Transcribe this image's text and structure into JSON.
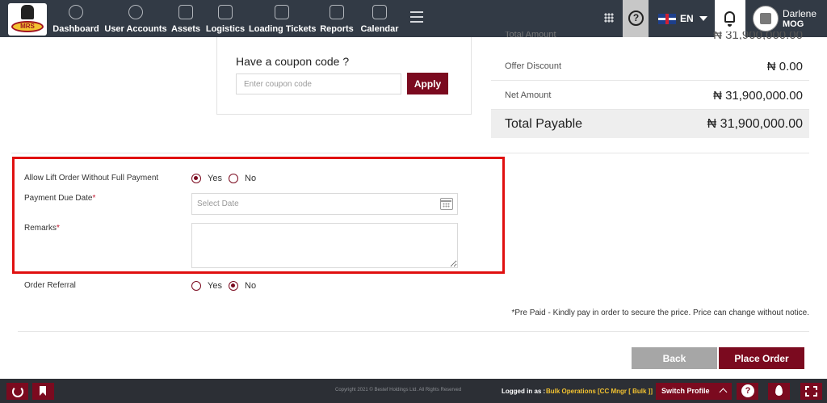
{
  "nav": {
    "logo_text": "MRS",
    "items": [
      {
        "label": "Dashboard",
        "icon": "dashboard-icon"
      },
      {
        "label": "User Accounts",
        "icon": "user-accounts-icon"
      },
      {
        "label": "Assets",
        "icon": "assets-icon"
      },
      {
        "label": "Logistics",
        "icon": "truck-icon"
      },
      {
        "label": "Loading Tickets",
        "icon": "ticket-icon"
      },
      {
        "label": "Reports",
        "icon": "reports-icon"
      },
      {
        "label": "Calendar",
        "icon": "calendar-icon"
      }
    ],
    "help_glyph": "?",
    "language": "EN",
    "user": {
      "name": "Darlene",
      "org": "MOG"
    }
  },
  "coupon": {
    "title": "Have a coupon code ?",
    "placeholder": "Enter coupon code",
    "apply_label": "Apply"
  },
  "summary": {
    "partial_label": "Total Amount",
    "partial_value": "₦ 31,900,000.00",
    "rows": [
      {
        "label": "Offer Discount",
        "value": "₦ 0.00"
      },
      {
        "label": "Net Amount",
        "value": "₦ 31,900,000.00"
      }
    ],
    "total_label": "Total Payable",
    "total_value": "₦ 31,900,000.00"
  },
  "form": {
    "lift_order_label": "Allow Lift Order Without Full Payment",
    "lift_order_selected": "Yes",
    "yes": "Yes",
    "no": "No",
    "due_date_label": "Payment Due Date",
    "due_date_placeholder": "Select Date",
    "remarks_label": "Remarks",
    "required_mark": "*",
    "referral_label": "Order Referral",
    "referral_selected": "No"
  },
  "note": "*Pre Paid - Kindly pay in order to secure the price. Price can change without notice.",
  "actions": {
    "back": "Back",
    "place_order": "Place Order"
  },
  "footer": {
    "copyright": "Copyright 2021 © Bestef Holdings Ltd. All Rights Reserved",
    "logged_in_label": "Logged in as :",
    "logged_in_value": "Bulk Operations [CC Mngr [ Bulk ]]",
    "switch_profile": "Switch Profile",
    "help_glyph": "?"
  },
  "colors": {
    "brand": "#7b0a1f",
    "nav_bg": "#323a45",
    "highlight": "#e01010"
  }
}
